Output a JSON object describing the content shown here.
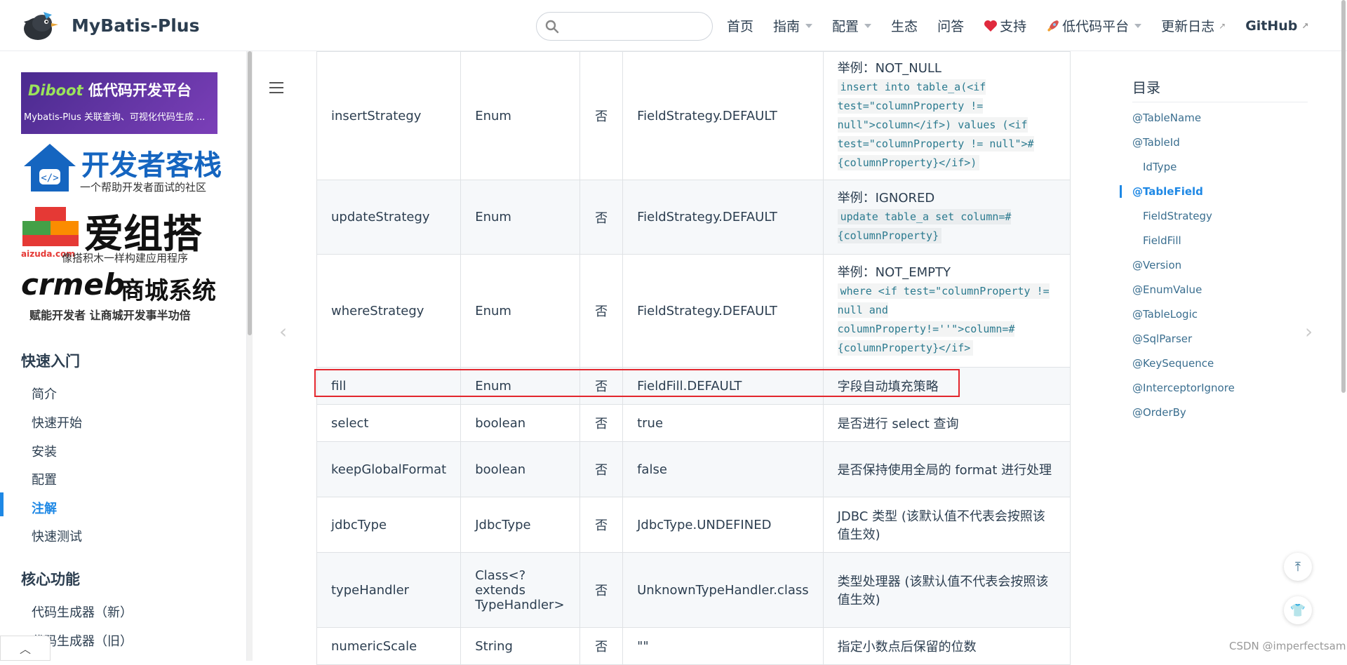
{
  "site": {
    "title": "MyBatis-Plus"
  },
  "search": {
    "placeholder": "",
    "value": ""
  },
  "nav": {
    "home": "首页",
    "guide": "指南",
    "config": "配置",
    "eco": "生态",
    "qa": "问答",
    "support": "支持",
    "lowcode": "低代码平台",
    "changelog": "更新日志",
    "github": "GitHub"
  },
  "ads": {
    "diboot_title": "低代码开发平台",
    "diboot_brand": "Diboot",
    "diboot_sub": "Mybatis-Plus 关联查询、可视化代码生成 ...",
    "dev_title": "开发者客栈",
    "dev_sub": "一个帮助开发者面试的社区",
    "aizuda_title": "爱组搭",
    "aizuda_domain": "aizuda.com",
    "aizuda_sub": "像搭积木一样构建应用程序",
    "crmeb_brand": "crmeb",
    "crmeb_title": "商城系统",
    "crmeb_sub": "赋能开发者 让商城开发事半功倍"
  },
  "sidebar": {
    "group1": "快速入门",
    "items1": [
      "简介",
      "快速开始",
      "安装",
      "配置",
      "注解",
      "快速测试"
    ],
    "group2": "核心功能",
    "items2": [
      "代码生成器（新）",
      "代码生成器（旧）"
    ]
  },
  "table": {
    "rows": [
      {
        "name": "insertStrategy",
        "type": "Enum",
        "required": "否",
        "default": "FieldStrategy.DEFAULT",
        "desc_prefix": "举例：NOT_NULL",
        "desc_code": "insert into table_a(<if test=\"columnProperty != null\">column</if>) values (<if test=\"columnProperty != null\">#{columnProperty}</if>)"
      },
      {
        "name": "updateStrategy",
        "type": "Enum",
        "required": "否",
        "default": "FieldStrategy.DEFAULT",
        "desc_prefix": "举例：IGNORED",
        "desc_code": "update table_a set column=#{columnProperty}"
      },
      {
        "name": "whereStrategy",
        "type": "Enum",
        "required": "否",
        "default": "FieldStrategy.DEFAULT",
        "desc_prefix": "举例：NOT_EMPTY",
        "desc_code": "where <if test=\"columnProperty != null and columnProperty!=''\">column=#{columnProperty}</if>"
      },
      {
        "name": "fill",
        "type": "Enum",
        "required": "否",
        "default": "FieldFill.DEFAULT",
        "desc": "字段自动填充策略"
      },
      {
        "name": "select",
        "type": "boolean",
        "required": "否",
        "default": "true",
        "desc": "是否进行 select 查询"
      },
      {
        "name": "keepGlobalFormat",
        "type": "boolean",
        "required": "否",
        "default": "false",
        "desc": "是否保持使用全局的 format 进行处理"
      },
      {
        "name": "jdbcType",
        "type": "JdbcType",
        "required": "否",
        "default": "JdbcType.UNDEFINED",
        "desc": "JDBC 类型 (该默认值不代表会按照该值生效)"
      },
      {
        "name": "typeHandler",
        "type": "Class<? extends TypeHandler>",
        "required": "否",
        "default": "UnknownTypeHandler.class",
        "desc": "类型处理器 (该默认值不代表会按照该值生效)"
      },
      {
        "name": "numericScale",
        "type": "String",
        "required": "否",
        "default": "\"\"",
        "desc": "指定小数点后保留的位数"
      }
    ]
  },
  "toc": {
    "title": "目录",
    "items": [
      "@TableName",
      "@TableId",
      "IdType",
      "@TableField",
      "FieldStrategy",
      "FieldFill",
      "@Version",
      "@EnumValue",
      "@TableLogic",
      "@SqlParser",
      "@KeySequence",
      "@InterceptorIgnore",
      "@OrderBy"
    ]
  },
  "watermark": "CSDN @imperfectsam",
  "colors": {
    "accent": "#1e88e5",
    "highlight_border": "#e3262d",
    "text": "#2c3e50"
  }
}
